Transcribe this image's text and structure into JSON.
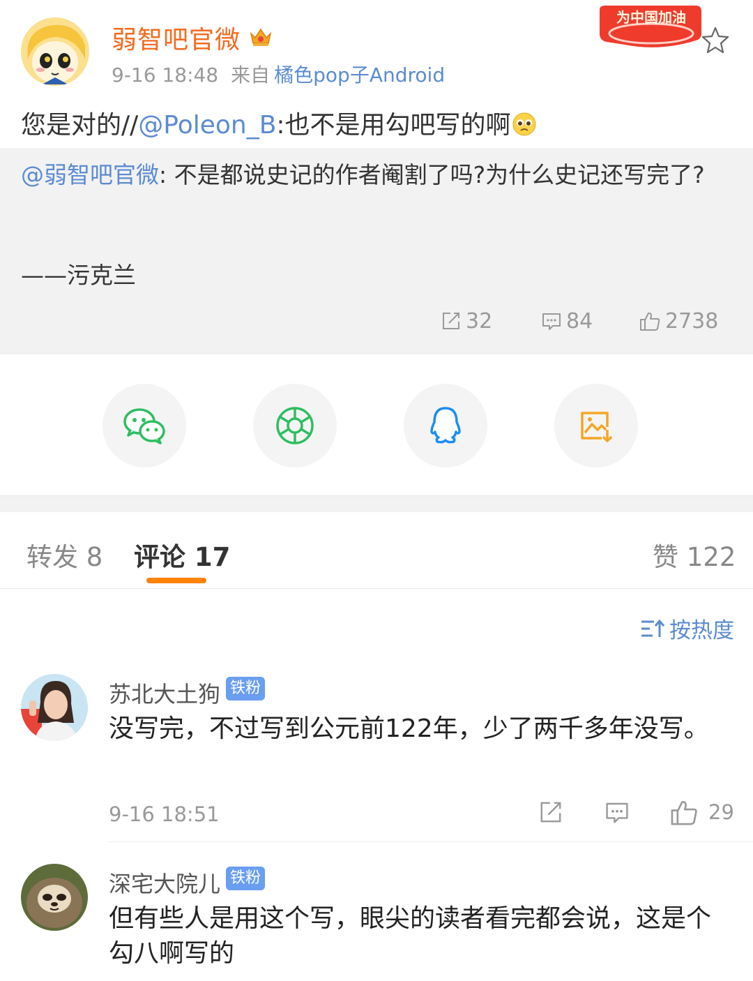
{
  "post": {
    "author": "弱智吧官微",
    "time": "9-16 18:48",
    "from_label": "来自",
    "source": "橘色pop子Android",
    "promo_text": "为中国加油",
    "text_prefix": "您是对的//",
    "mention": "@Poleon_B",
    "text_suffix": ":也不是用勾吧写的啊",
    "emoji": "pleading-face-emoji"
  },
  "quoted": {
    "mention": "@弱智吧官微",
    "body": ": 不是都说史记的作者阉割了吗?为什么史记还写完了?",
    "signature": "——污克兰",
    "reposts": "32",
    "comments": "84",
    "likes": "2738"
  },
  "share": [
    {
      "name": "wechat-icon",
      "color": "#2dbe60"
    },
    {
      "name": "moments-icon",
      "color": "#2dbe60"
    },
    {
      "name": "qq-icon",
      "color": "#1b8ef5"
    },
    {
      "name": "save-image-icon",
      "color": "#f5a623"
    }
  ],
  "tabs": {
    "repost_label": "转发",
    "repost_count": "8",
    "comment_label": "评论",
    "comment_count": "17",
    "like_label": "赞",
    "like_count": "122"
  },
  "sort_label": "按热度",
  "comments": [
    {
      "user": "苏北大土狗",
      "badge": "铁粉",
      "text": "没写完，不过写到公元前122年，少了两千多年没写。",
      "time": "9-16 18:51",
      "likes": "29"
    },
    {
      "user": "深宅大院儿",
      "badge": "铁粉",
      "text": "但有些人是用这个写，眼尖的读者看完都会说，这是个勾八啊写的"
    }
  ],
  "colors": {
    "accent": "#ff8200",
    "author": "#f56a1e",
    "link": "#5b8bd2",
    "badge": "#6a9ef0"
  }
}
